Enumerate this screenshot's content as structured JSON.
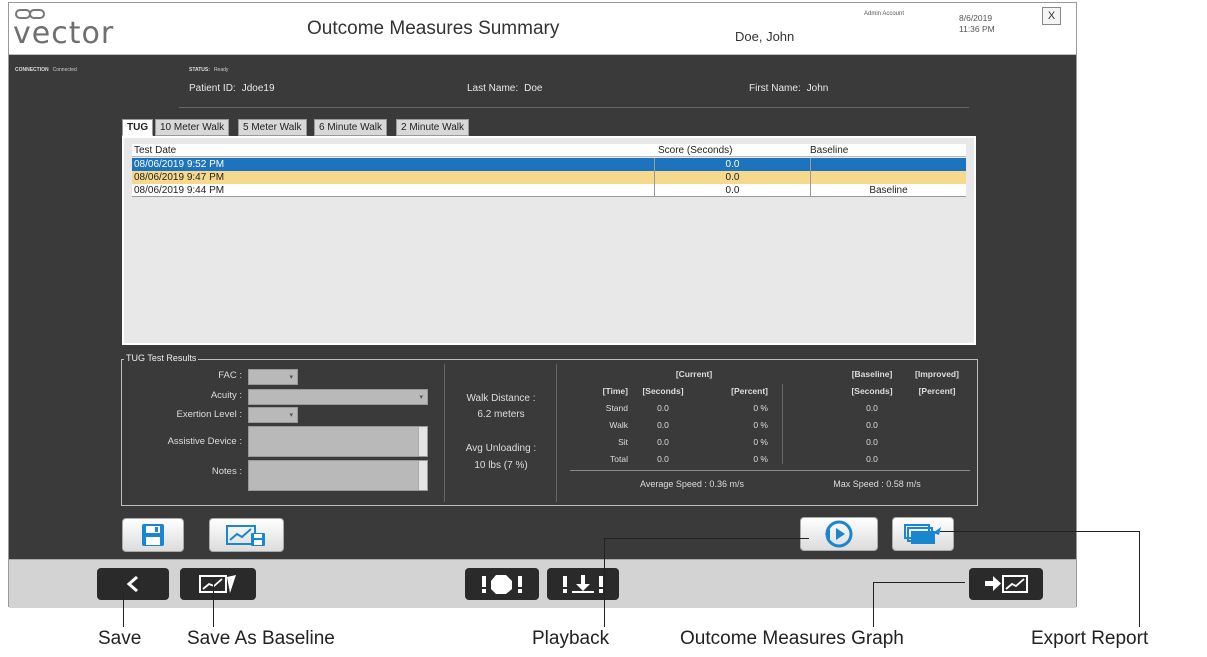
{
  "header": {
    "logo_text": "vector",
    "title": "Outcome Measures Summary",
    "patient_name": "Doe, John",
    "account": "Admin Account",
    "date": "8/6/2019",
    "time": "11:36 PM",
    "close_label": "X"
  },
  "status_bar": {
    "connection_label": "CONNECTION",
    "connection_value": "Connected",
    "status_label": "STATUS:",
    "status_value": "Ready"
  },
  "patient": {
    "id_label": "Patient ID:",
    "id_value": "Jdoe19",
    "last_name_label": "Last Name:",
    "last_name_value": "Doe",
    "first_name_label": "First Name:",
    "first_name_value": "John"
  },
  "tabs": [
    {
      "label": "TUG",
      "active": true
    },
    {
      "label": "10 Meter Walk",
      "active": false
    },
    {
      "label": "5 Meter Walk",
      "active": false
    },
    {
      "label": "6 Minute Walk",
      "active": false
    },
    {
      "label": "2 Minute Walk",
      "active": false
    }
  ],
  "grid": {
    "columns": [
      "Test Date",
      "Score (Seconds)",
      "Baseline"
    ],
    "rows": [
      {
        "date": "08/06/2019 9:52 PM",
        "score": "0.0",
        "baseline": "",
        "state": "selected"
      },
      {
        "date": "08/06/2019 9:47 PM",
        "score": "0.0",
        "baseline": "",
        "state": "highlighted"
      },
      {
        "date": "08/06/2019 9:44 PM",
        "score": "0.0",
        "baseline": "Baseline",
        "state": "normal"
      }
    ]
  },
  "results": {
    "legend": "TUG Test Results",
    "fac_label": "FAC :",
    "acuity_label": "Acuity :",
    "exertion_label": "Exertion Level :",
    "device_label": "Assistive Device :",
    "notes_label": "Notes :",
    "walk_distance_label": "Walk Distance :",
    "walk_distance_value": "6.2 meters",
    "avg_unloading_label": "Avg Unloading :",
    "avg_unloading_value": "10  lbs (7 %)",
    "current_header": "[Current]",
    "time_header": "[Time]",
    "seconds_header": "[Seconds]",
    "percent_header": "[Percent]",
    "baseline_header": "[Baseline]",
    "baseline_seconds_header": "[Seconds]",
    "improved_header": "[Improved]",
    "improved_percent_header": "[Percent]",
    "rows": [
      {
        "label": "Stand",
        "seconds": "0.0",
        "percent": "0 %",
        "baseline": "0.0"
      },
      {
        "label": "Walk",
        "seconds": "0.0",
        "percent": "0 %",
        "baseline": "0.0"
      },
      {
        "label": "Sit",
        "seconds": "0.0",
        "percent": "0 %",
        "baseline": "0.0"
      },
      {
        "label": "Total",
        "seconds": "0.0",
        "percent": "0 %",
        "baseline": "0.0"
      }
    ],
    "avg_speed": "Average Speed :  0.36 m/s",
    "max_speed": "Max Speed :  0.58 m/s"
  },
  "callouts": {
    "save": "Save",
    "save_baseline": "Save As Baseline",
    "playback": "Playback",
    "graph": "Outcome Measures Graph",
    "export": "Export Report"
  },
  "colors": {
    "selected_row": "#1e73be",
    "highlighted_row": "#f7d98d",
    "icon_blue": "#1a86d0",
    "panel_bg": "#3a3a3a"
  }
}
